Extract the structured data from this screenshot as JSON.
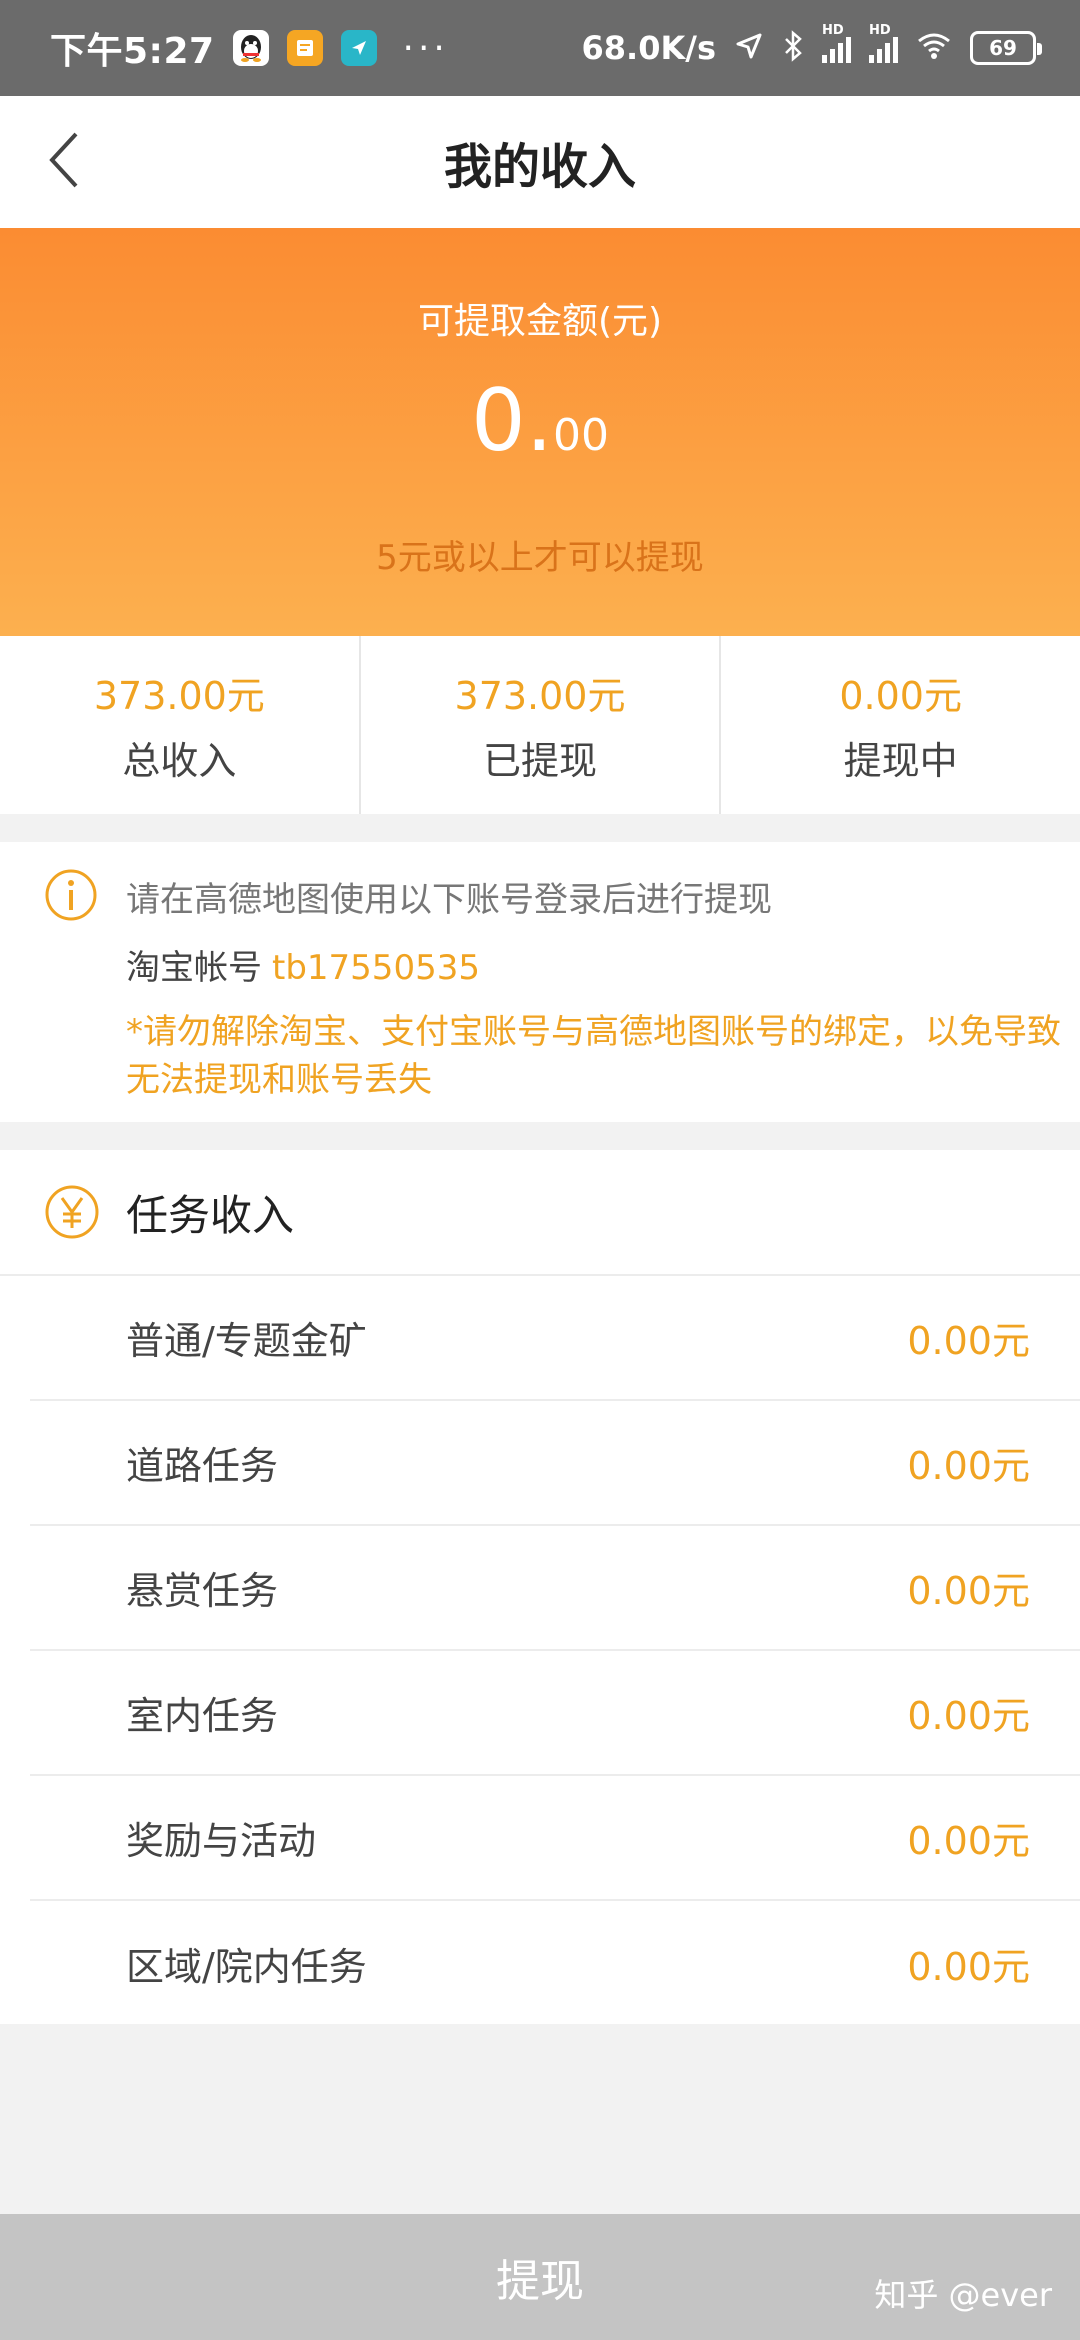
{
  "status_bar": {
    "time": "下午5:27",
    "dots": "···",
    "speed": "68.0K/s",
    "hd": "HD",
    "battery": "69",
    "icons": [
      "qq-icon",
      "notes-app-icon",
      "navigation-app-icon",
      "location-arrow-icon",
      "bluetooth-icon",
      "signal-icon",
      "signal-icon",
      "wifi-icon",
      "battery-icon"
    ]
  },
  "header": {
    "title": "我的收入",
    "back_icon": "chevron-left-icon"
  },
  "balance": {
    "label": "可提取金额(元)",
    "amount_int": "0.",
    "amount_dec": "00",
    "tip": "5元或以上才可以提现"
  },
  "stats": [
    {
      "value": "373.00元",
      "label": "总收入"
    },
    {
      "value": "373.00元",
      "label": "已提现"
    },
    {
      "value": "0.00元",
      "label": "提现中"
    }
  ],
  "notice": {
    "line1": "请在高德地图使用以下账号登录后进行提现",
    "account_label": "淘宝帐号",
    "account_value": "tb17550535",
    "warning": "*请勿解除淘宝、支付宝账号与高德地图账号的绑定，以免导致无法提现和账号丢失"
  },
  "tasks": {
    "title": "任务收入",
    "items": [
      {
        "name": "普通/专题金矿",
        "amount": "0.00元"
      },
      {
        "name": "道路任务",
        "amount": "0.00元"
      },
      {
        "name": "悬赏任务",
        "amount": "0.00元"
      },
      {
        "name": "室内任务",
        "amount": "0.00元"
      },
      {
        "name": "奖励与活动",
        "amount": "0.00元"
      },
      {
        "name": "区域/院内任务",
        "amount": "0.00元"
      }
    ]
  },
  "withdraw_button": "提现",
  "watermark": "知乎 @ever",
  "colors": {
    "accent": "#f0a322",
    "header_top": "#fb8c32",
    "header_bottom": "#fcb04f",
    "button_disabled": "#c4c4c4",
    "status_bar": "#6b6b6b"
  }
}
